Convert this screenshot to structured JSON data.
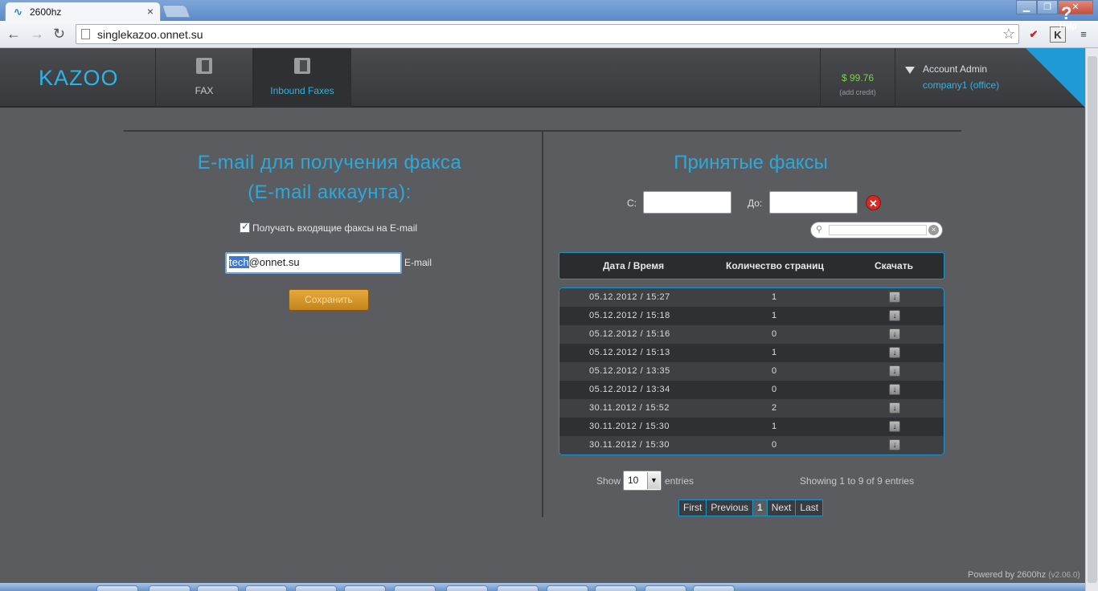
{
  "browser": {
    "tab_title": "2600hz",
    "tab_close": "×",
    "url": "singlekazoo.onnet.su",
    "window_buttons": [
      "▁",
      "❐",
      "✕"
    ],
    "ext_icons": [
      "✔",
      "K",
      "≡"
    ]
  },
  "header": {
    "logo": "KAZOO",
    "nav": [
      {
        "label": "FAX",
        "active": false
      },
      {
        "label": "Inbound Faxes",
        "active": true
      }
    ],
    "credit": {
      "amount": "$ 99.76",
      "add": "(add credit)"
    },
    "account": {
      "name": "Account Admin",
      "company": "company1 (office)"
    },
    "help": {
      "icon": "?",
      "label": "Help"
    }
  },
  "left": {
    "title_line1": "E-mail для получения факса",
    "title_line2": "(E-mail аккаунта):",
    "checkbox_label": "Получать входящие факсы на E-mail",
    "checkbox_checked": true,
    "email_selected": "tech",
    "email_rest": "@onnet.su",
    "email_label": "E-mail",
    "save_label": "Сохранить"
  },
  "right": {
    "title": "Принятые факсы",
    "from_label": "С:",
    "to_label": "До:",
    "clear_icon": "✕",
    "columns": [
      "Дата / Время",
      "Количество страниц",
      "Скачать"
    ],
    "rows": [
      {
        "date": "05.12.2012 / 15:27",
        "pages": "1"
      },
      {
        "date": "05.12.2012 / 15:18",
        "pages": "1"
      },
      {
        "date": "05.12.2012 / 15:16",
        "pages": "0"
      },
      {
        "date": "05.12.2012 / 15:13",
        "pages": "1"
      },
      {
        "date": "05.12.2012 / 13:35",
        "pages": "0"
      },
      {
        "date": "05.12.2012 / 13:34",
        "pages": "0"
      },
      {
        "date": "30.11.2012 / 15:52",
        "pages": "2"
      },
      {
        "date": "30.11.2012 / 15:30",
        "pages": "1"
      },
      {
        "date": "30.11.2012 / 15:30",
        "pages": "0"
      }
    ],
    "show_label": "Show",
    "show_value": "10",
    "entries_label": "entries",
    "showing_text": "Showing 1 to 9 of 9 entries",
    "pager": [
      "First",
      "Previous",
      "1",
      "Next",
      "Last"
    ]
  },
  "footer": {
    "powered": "Powered by 2600hz",
    "version": "(v2.06.0)"
  },
  "colors": {
    "accent": "#2aa9dc",
    "credit": "#7ad34a",
    "save": "#d8982a",
    "help": "#1f9ad6"
  }
}
